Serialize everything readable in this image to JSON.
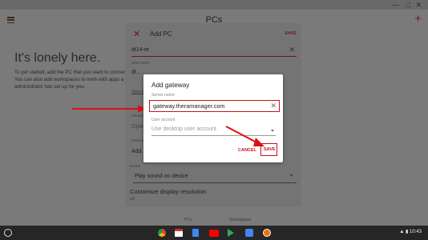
{
  "app": {
    "title": "PCs",
    "empty_title": "It's lonely here.",
    "empty_lines": [
      "To get started, add the PC that you want to connect",
      "You can also add workspaces to work with apps a",
      "administrator has set up for you."
    ],
    "tabs": [
      "PCs",
      "Workspaces"
    ]
  },
  "add_pc": {
    "title": "Add PC",
    "save_label": "SAVE",
    "pc_name_value": "dt14-et",
    "user_name_label": "User name",
    "user_name_value": "dt...",
    "link_text": "How d...",
    "fields": [
      {
        "label": "Friendl...",
        "value": "Optio..."
      },
      {
        "label": "General",
        "value": "Add..."
      }
    ],
    "sound_label": "Sound",
    "sound_value": "Play sound on device",
    "display_title": "Customize display resolution",
    "display_value": "Off"
  },
  "dialog": {
    "title": "Add gateway",
    "server_label": "Server name",
    "server_value": "gateway.theramanager.com",
    "user_account_label": "User account",
    "user_account_value": "Use desktop user account",
    "cancel_label": "CANCEL",
    "save_label": "SAVE"
  },
  "shelf": {
    "time": "10:43",
    "apps": [
      "chrome-icon",
      "gmail-icon",
      "docs-icon",
      "youtube-icon",
      "play-store-icon",
      "files-icon",
      "remote-desktop-icon"
    ]
  },
  "colors": {
    "accent": "#c8141c",
    "scrim": "#7a7a7a",
    "shelf": "#262626"
  }
}
